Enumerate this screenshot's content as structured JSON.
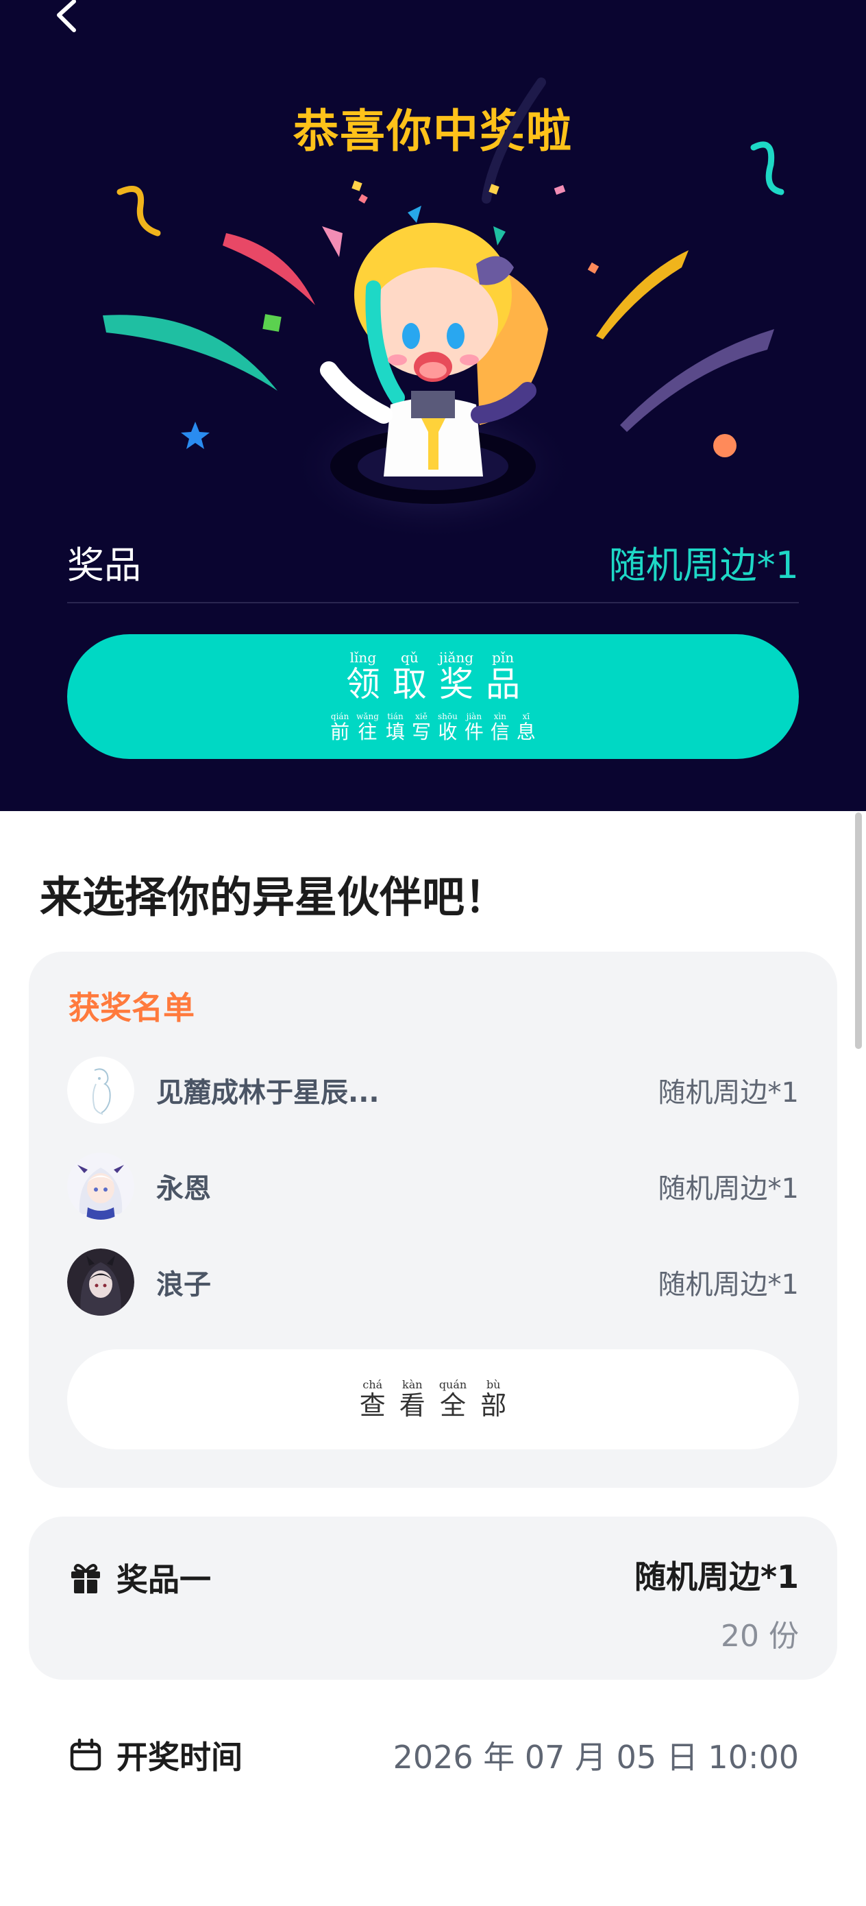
{
  "hero": {
    "title": "恭喜你中奖啦",
    "prize_label": "奖品",
    "prize_value": "随机周边*1",
    "claim_button": {
      "main": [
        {
          "py": "lǐng",
          "hz": "领"
        },
        {
          "py": "qǔ",
          "hz": "取"
        },
        {
          "py": "jiǎng",
          "hz": "奖"
        },
        {
          "py": "pǐn",
          "hz": "品"
        }
      ],
      "sub": [
        {
          "py": "qián",
          "hz": "前"
        },
        {
          "py": "wǎng",
          "hz": "往"
        },
        {
          "py": "tián",
          "hz": "填"
        },
        {
          "py": "xiě",
          "hz": "写"
        },
        {
          "py": "shōu",
          "hz": "收"
        },
        {
          "py": "jiàn",
          "hz": "件"
        },
        {
          "py": "xìn",
          "hz": "信"
        },
        {
          "py": "xī",
          "hz": "息"
        }
      ]
    }
  },
  "section_title": "来选择你的异星伙伴吧！",
  "winners": {
    "heading": "获奖名单",
    "rows": [
      {
        "name": "见麓成林于星辰...",
        "prize": "随机周边*1",
        "avatar": "sketch-avatar"
      },
      {
        "name": "永恩",
        "prize": "随机周边*1",
        "avatar": "anime-girl-white-hair-avatar"
      },
      {
        "name": "浪子",
        "prize": "随机周边*1",
        "avatar": "anime-girl-dark-avatar"
      }
    ],
    "view_all": [
      {
        "py": "chá",
        "hz": "查"
      },
      {
        "py": "kàn",
        "hz": "看"
      },
      {
        "py": "quán",
        "hz": "全"
      },
      {
        "py": "bù",
        "hz": "部"
      }
    ]
  },
  "prize_card": {
    "label": "奖品一",
    "value": "随机周边*1",
    "count": "20 份",
    "icon": "gift-icon"
  },
  "draw": {
    "label": "开奖时间",
    "time": "2026 年 07 月 05 日 10:00",
    "icon": "calendar-icon"
  },
  "colors": {
    "hero_bg": "#0a0530",
    "title_yellow": "#ffc21a",
    "accent_teal": "#00d8c4",
    "winners_orange": "#ff7a3d"
  }
}
